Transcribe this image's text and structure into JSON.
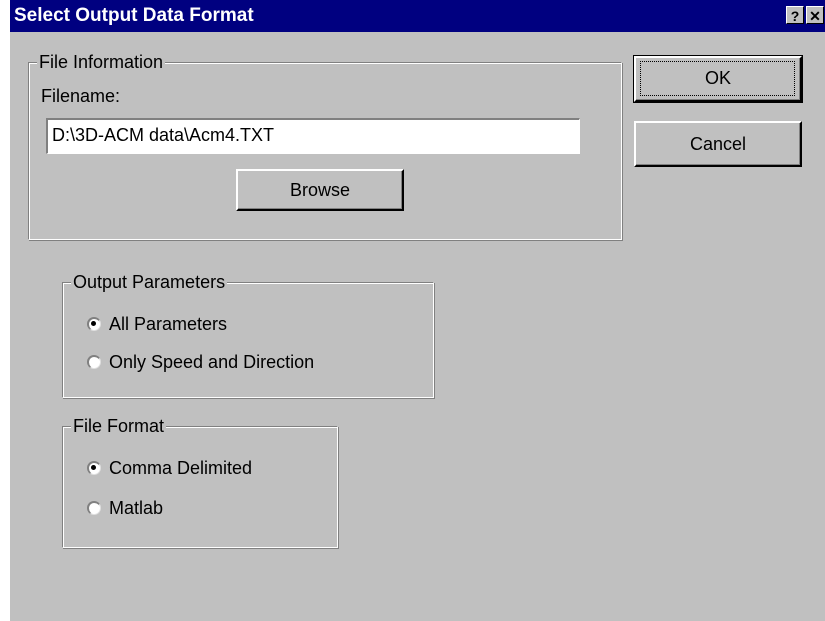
{
  "dialog": {
    "title": "Select Output Data Format",
    "help_label": "?",
    "close_label": "✕"
  },
  "file_info": {
    "legend": "File Information",
    "filename_label": "Filename:",
    "filename_value": "D:\\3D-ACM data\\Acm4.TXT",
    "browse_label": "Browse"
  },
  "buttons": {
    "ok_label": "OK",
    "cancel_label": "Cancel"
  },
  "output_parameters": {
    "legend": "Output Parameters",
    "options": [
      {
        "label": "All Parameters",
        "checked": true
      },
      {
        "label": "Only Speed and Direction",
        "checked": false
      }
    ]
  },
  "file_format": {
    "legend": "File Format",
    "options": [
      {
        "label": "Comma Delimited",
        "checked": true
      },
      {
        "label": "Matlab",
        "checked": false
      }
    ]
  }
}
